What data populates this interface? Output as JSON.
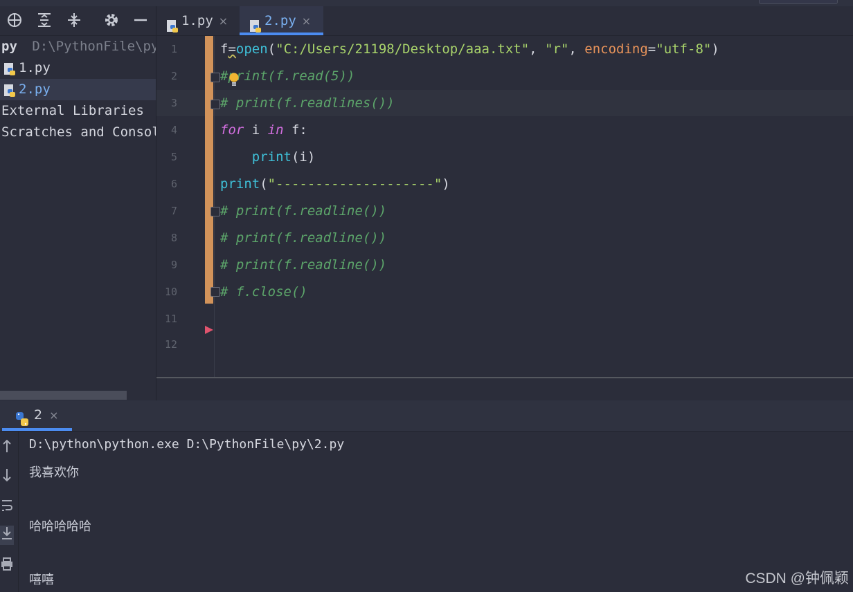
{
  "toolbar": {
    "icons": [
      "locate-icon",
      "expand-all-icon",
      "collapse-all-icon",
      "gear-icon",
      "minimize-icon"
    ]
  },
  "project": {
    "root_name": "py",
    "root_path": "D:\\PythonFile\\py",
    "items": [
      {
        "label": "1.py"
      },
      {
        "label": "2.py"
      }
    ],
    "external_libraries": "External Libraries",
    "scratches": "Scratches and Consoles"
  },
  "tabs": [
    {
      "label": "1.py",
      "close": "×"
    },
    {
      "label": "2.py",
      "close": "×"
    }
  ],
  "editor": {
    "line_numbers": [
      "1",
      "2",
      "3",
      "4",
      "5",
      "6",
      "7",
      "8",
      "9",
      "10",
      "11",
      "12"
    ],
    "lines": {
      "l1": {
        "a": "f",
        "b": "=",
        "c": "open",
        "d": "(",
        "e": "\"C:/Users/21198/Desktop/aaa.txt\"",
        "f": ", ",
        "g": "\"r\"",
        "h": ", ",
        "i": "encoding",
        "j": "=",
        "k": "\"utf-8\"",
        "l": ")"
      },
      "l2": "#print(f.read(5))",
      "l3": "# print(f.readlines())",
      "l4": {
        "a": "for",
        "b": " i ",
        "c": "in",
        "d": " f:"
      },
      "l5": {
        "a": "    ",
        "b": "print",
        "c": "(i)"
      },
      "l6": {
        "a": "print",
        "b": "(",
        "c": "\"--------------------\"",
        "d": ")"
      },
      "l7": "# print(f.readline())",
      "l8": "# print(f.readline())",
      "l9": "# print(f.readline())",
      "l10": "# f.close()"
    }
  },
  "run": {
    "tab_label": "2",
    "tab_close": "×",
    "command": "D:\\python\\python.exe D:\\PythonFile\\py\\2.py",
    "output": [
      "我喜欢你",
      "",
      "哈哈哈哈哈",
      "",
      "嘻嘻"
    ]
  },
  "watermark": "CSDN @钟佩颖",
  "colors": {
    "accent": "#4c8cf0",
    "keyword": "#d36fe0",
    "function": "#3fc0d8",
    "string": "#a9d46b",
    "kwarg": "#e8935a",
    "comment": "#5ca56a",
    "change_bar": "#d2935a",
    "breakpoint_arrow": "#e0546e"
  }
}
